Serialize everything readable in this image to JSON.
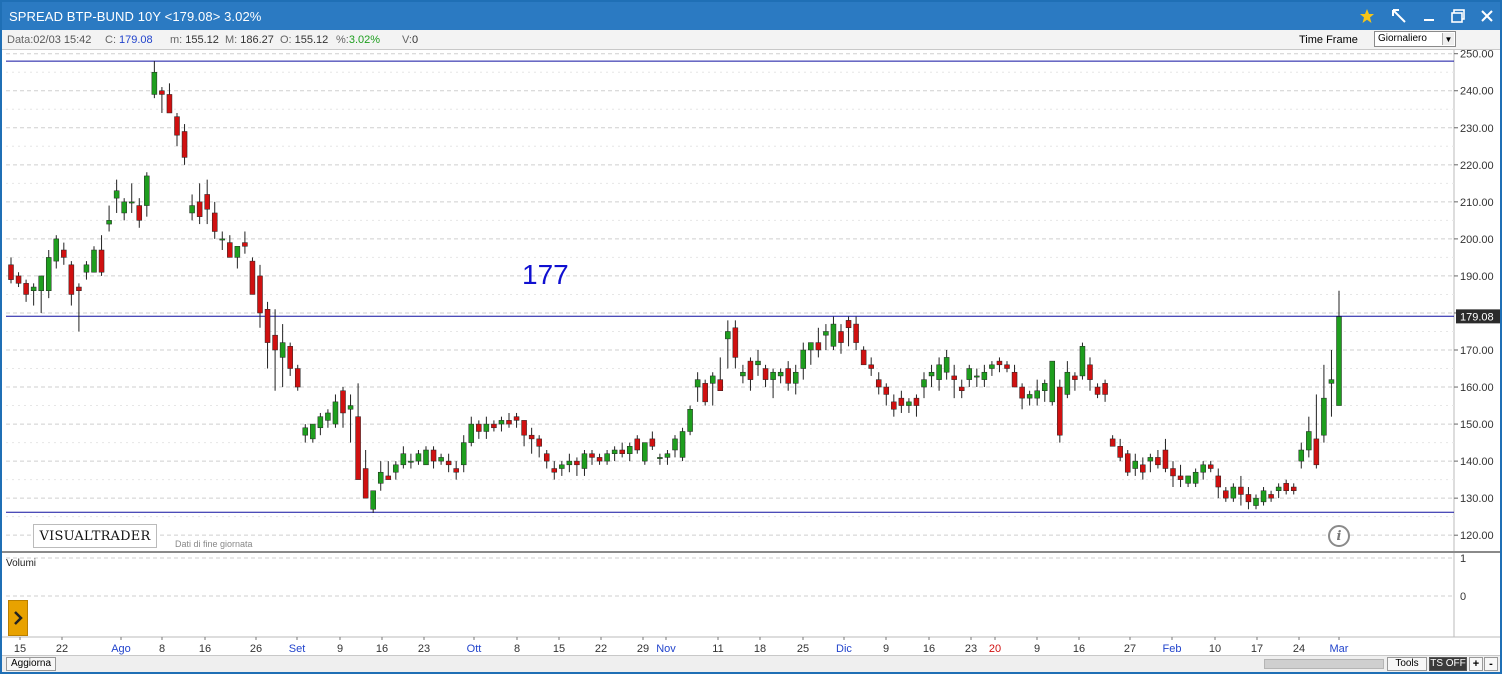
{
  "window": {
    "title": "SPREAD BTP-BUND 10Y <179.08> 3.02%"
  },
  "infobar": {
    "data_label": "Data:",
    "data_value": "02/03 15:42",
    "c_label": "C:",
    "c_value": "179.08",
    "m_label": "m:",
    "m_value": "155.12",
    "M_label": "M:",
    "M_value": "186.27",
    "o_label": "O:",
    "o_value": "155.12",
    "pct_label": "%:",
    "pct_value": "3.02%",
    "v_label": "V:",
    "v_value": "0",
    "time_frame_label": "Time Frame",
    "time_frame_value": "Giornaliero"
  },
  "branding": {
    "logo": "VISUALTRADER",
    "note": "Dati di fine giornata"
  },
  "bottom": {
    "aggiorna": "Aggiorna",
    "tools": "Tools",
    "ts_off": "TS OFF",
    "zoom_in": "+",
    "zoom_out": "-"
  },
  "colors": {
    "up": "#1e9e1e",
    "down": "#d01010",
    "line": "#1010a0",
    "month_label": "#2244cc",
    "special_label": "#d01010"
  },
  "chart_data": {
    "type": "candlestick",
    "title": "SPREAD BTP-BUND 10Y",
    "ylim": [
      116,
      251
    ],
    "yticks": [
      120,
      130,
      140,
      150,
      160,
      170,
      180,
      190,
      200,
      210,
      220,
      230,
      240,
      250
    ],
    "last_price": "179.08",
    "last_value": 179.08,
    "horizontal_lines": [
      248,
      179.1,
      126.2
    ],
    "annotation": "177",
    "volume_panel": {
      "label": "Volumi",
      "yticks": [
        "1",
        "0"
      ]
    },
    "x_labels": [
      {
        "label": "15",
        "type": "day"
      },
      {
        "label": "22",
        "type": "day"
      },
      {
        "label": "Ago",
        "type": "month"
      },
      {
        "label": "8",
        "type": "day"
      },
      {
        "label": "16",
        "type": "day"
      },
      {
        "label": "26",
        "type": "day"
      },
      {
        "label": "Set",
        "type": "month"
      },
      {
        "label": "9",
        "type": "day"
      },
      {
        "label": "16",
        "type": "day"
      },
      {
        "label": "23",
        "type": "day"
      },
      {
        "label": "Ott",
        "type": "month"
      },
      {
        "label": "8",
        "type": "day"
      },
      {
        "label": "15",
        "type": "day"
      },
      {
        "label": "22",
        "type": "day"
      },
      {
        "label": "29",
        "type": "day"
      },
      {
        "label": "Nov",
        "type": "month"
      },
      {
        "label": "11",
        "type": "day"
      },
      {
        "label": "18",
        "type": "day"
      },
      {
        "label": "25",
        "type": "day"
      },
      {
        "label": "Dic",
        "type": "month"
      },
      {
        "label": "9",
        "type": "day"
      },
      {
        "label": "16",
        "type": "day"
      },
      {
        "label": "23",
        "type": "day"
      },
      {
        "label": "20",
        "type": "special"
      },
      {
        "label": "9",
        "type": "day"
      },
      {
        "label": "16",
        "type": "day"
      },
      {
        "label": "27",
        "type": "day"
      },
      {
        "label": "Feb",
        "type": "month"
      },
      {
        "label": "10",
        "type": "day"
      },
      {
        "label": "17",
        "type": "day"
      },
      {
        "label": "24",
        "type": "day"
      },
      {
        "label": "Mar",
        "type": "month"
      }
    ],
    "candles": [
      [
        193,
        195,
        188,
        189
      ],
      [
        190,
        191,
        187,
        188
      ],
      [
        188,
        189,
        183,
        185
      ],
      [
        186,
        188,
        182,
        187
      ],
      [
        186,
        190,
        180,
        190
      ],
      [
        186,
        197,
        184,
        195
      ],
      [
        194,
        201,
        192,
        200
      ],
      [
        197,
        199,
        193,
        195
      ],
      [
        193,
        194,
        182,
        185
      ],
      [
        187,
        188,
        175,
        186
      ],
      [
        191,
        194,
        189,
        193
      ],
      [
        191,
        198,
        191,
        197
      ],
      [
        197,
        201,
        190,
        191
      ],
      [
        204,
        209,
        202,
        205
      ],
      [
        211,
        216,
        207,
        213
      ],
      [
        207,
        211,
        205,
        210
      ],
      [
        210,
        215,
        207,
        210
      ],
      [
        209,
        211,
        203,
        205
      ],
      [
        209,
        218,
        206,
        217
      ],
      [
        239,
        248,
        238,
        245
      ],
      [
        240,
        241,
        234,
        239
      ],
      [
        239,
        242,
        236,
        234
      ],
      [
        233,
        234,
        225,
        228
      ],
      [
        229,
        231,
        220,
        222
      ],
      [
        207,
        212,
        205,
        209
      ],
      [
        210,
        215,
        204,
        206
      ],
      [
        212,
        216,
        204,
        208
      ],
      [
        207,
        210,
        200,
        202
      ],
      [
        200,
        202,
        197,
        200
      ],
      [
        199,
        201,
        197,
        195
      ],
      [
        195,
        197,
        192,
        198
      ],
      [
        199,
        202,
        196,
        198
      ],
      [
        194,
        195,
        187,
        185
      ],
      [
        190,
        193,
        176,
        180
      ],
      [
        181,
        183,
        165,
        172
      ],
      [
        174,
        181,
        159,
        170
      ],
      [
        168,
        177,
        160,
        172
      ],
      [
        171,
        172,
        163,
        165
      ],
      [
        165,
        166,
        159,
        160
      ],
      [
        147,
        150,
        145,
        149
      ],
      [
        146,
        150,
        145,
        150
      ],
      [
        149,
        153,
        147,
        152
      ],
      [
        151,
        154,
        149,
        153
      ],
      [
        150,
        158,
        149,
        156
      ],
      [
        159,
        160,
        149,
        153
      ],
      [
        154,
        158,
        145,
        155
      ],
      [
        152,
        161,
        139,
        135
      ],
      [
        138,
        143,
        132,
        130
      ],
      [
        127,
        132,
        126,
        132
      ],
      [
        134,
        140,
        132,
        137
      ],
      [
        136,
        140,
        135,
        135
      ],
      [
        137,
        140,
        135,
        139
      ],
      [
        139,
        144,
        138,
        142
      ],
      [
        140,
        142,
        138,
        140
      ],
      [
        140,
        143,
        139,
        142
      ],
      [
        139,
        144,
        139,
        143
      ],
      [
        143,
        144,
        138,
        140
      ],
      [
        140,
        142,
        139,
        141
      ],
      [
        140,
        142,
        137,
        139
      ],
      [
        138,
        140,
        135,
        137
      ],
      [
        139,
        147,
        137,
        145
      ],
      [
        145,
        152,
        144,
        150
      ],
      [
        150,
        151,
        146,
        148
      ],
      [
        148,
        152,
        146,
        150
      ],
      [
        150,
        151,
        148,
        149
      ],
      [
        150,
        152,
        148,
        151
      ],
      [
        151,
        153,
        149,
        150
      ],
      [
        152,
        153,
        149,
        151
      ],
      [
        151,
        151,
        144,
        147
      ],
      [
        147,
        149,
        142,
        146
      ],
      [
        146,
        147,
        141,
        144
      ],
      [
        142,
        143,
        138,
        140
      ],
      [
        138,
        140,
        135,
        137
      ],
      [
        138,
        140,
        136,
        139
      ],
      [
        139,
        142,
        137,
        140
      ],
      [
        140,
        141,
        136,
        139
      ],
      [
        138,
        143,
        136,
        142
      ],
      [
        142,
        143,
        139,
        141
      ],
      [
        141,
        142,
        139,
        140
      ],
      [
        140,
        143,
        139,
        142
      ],
      [
        142,
        144,
        140,
        143
      ],
      [
        143,
        145,
        141,
        142
      ],
      [
        142,
        145,
        140,
        144
      ],
      [
        146,
        147,
        142,
        143
      ],
      [
        140,
        144,
        139,
        145
      ],
      [
        146,
        148,
        143,
        144
      ],
      [
        141,
        142,
        139,
        141
      ],
      [
        141,
        143,
        139,
        142
      ],
      [
        143,
        147,
        141,
        146
      ],
      [
        141,
        149,
        140,
        148
      ],
      [
        148,
        155,
        147,
        154
      ],
      [
        160,
        164,
        156,
        162
      ],
      [
        161,
        162,
        155,
        156
      ],
      [
        161,
        164,
        155,
        163
      ],
      [
        162,
        168,
        160,
        159
      ],
      [
        173,
        178,
        165,
        175
      ],
      [
        176,
        178,
        165,
        168
      ],
      [
        163,
        166,
        161,
        164
      ],
      [
        167,
        168,
        159,
        162
      ],
      [
        166,
        170,
        163,
        167
      ],
      [
        165,
        166,
        160,
        162
      ],
      [
        162,
        165,
        157,
        164
      ],
      [
        163,
        165,
        161,
        164
      ],
      [
        165,
        167,
        159,
        161
      ],
      [
        161,
        166,
        158,
        164
      ],
      [
        165,
        172,
        162,
        170
      ],
      [
        170,
        172,
        166,
        172
      ],
      [
        172,
        176,
        168,
        170
      ],
      [
        174,
        177,
        170,
        175
      ],
      [
        171,
        179,
        170,
        177
      ],
      [
        175,
        177,
        169,
        172
      ],
      [
        178,
        179,
        171,
        176
      ],
      [
        177,
        179,
        170,
        172
      ],
      [
        170,
        171,
        167,
        166
      ],
      [
        166,
        168,
        163,
        165
      ],
      [
        162,
        164,
        158,
        160
      ],
      [
        160,
        161,
        155,
        158
      ],
      [
        156,
        158,
        152,
        154
      ],
      [
        157,
        159,
        153,
        155
      ],
      [
        155,
        157,
        153,
        156
      ],
      [
        157,
        158,
        152,
        155
      ],
      [
        160,
        164,
        157,
        162
      ],
      [
        163,
        166,
        160,
        164
      ],
      [
        162,
        168,
        159,
        166
      ],
      [
        164,
        170,
        162,
        168
      ],
      [
        163,
        166,
        157,
        162
      ],
      [
        160,
        162,
        157,
        159
      ],
      [
        162,
        166,
        160,
        165
      ],
      [
        163,
        165,
        160,
        163
      ],
      [
        162,
        166,
        160,
        164
      ],
      [
        165,
        167,
        163,
        166
      ],
      [
        167,
        168,
        164,
        166
      ],
      [
        166,
        167,
        164,
        165
      ],
      [
        164,
        166,
        160,
        160
      ],
      [
        160,
        161,
        154,
        157
      ],
      [
        157,
        159,
        155,
        158
      ],
      [
        157,
        162,
        155,
        159
      ],
      [
        159,
        162,
        156,
        161
      ],
      [
        156,
        167,
        155,
        167
      ],
      [
        160,
        162,
        145,
        147
      ],
      [
        158,
        167,
        157,
        164
      ],
      [
        163,
        164,
        159,
        162
      ],
      [
        163,
        172,
        162,
        171
      ],
      [
        166,
        168,
        159,
        162
      ],
      [
        160,
        161,
        157,
        158
      ],
      [
        161,
        162,
        156,
        158
      ],
      [
        146,
        147,
        144,
        144
      ],
      [
        144,
        146,
        140,
        141
      ],
      [
        142,
        143,
        136,
        137
      ],
      [
        138,
        142,
        136,
        140
      ],
      [
        139,
        141,
        135,
        137
      ],
      [
        140,
        142,
        137,
        141
      ],
      [
        141,
        143,
        138,
        139
      ],
      [
        143,
        146,
        137,
        138
      ],
      [
        138,
        140,
        133,
        136
      ],
      [
        136,
        139,
        133,
        135
      ],
      [
        134,
        136,
        133,
        136
      ],
      [
        134,
        138,
        133,
        137
      ],
      [
        137,
        140,
        135,
        139
      ],
      [
        139,
        140,
        137,
        138
      ],
      [
        136,
        138,
        130,
        133
      ],
      [
        132,
        133,
        129,
        130
      ],
      [
        130,
        134,
        129,
        133
      ],
      [
        133,
        136,
        128,
        131
      ],
      [
        131,
        133,
        127,
        129
      ],
      [
        128,
        131,
        127,
        130
      ],
      [
        129,
        133,
        128,
        132
      ],
      [
        131,
        132,
        129,
        130
      ],
      [
        132,
        134,
        130,
        133
      ],
      [
        134,
        135,
        131,
        132
      ],
      [
        133,
        134,
        131,
        132
      ],
      [
        140,
        145,
        138,
        143
      ],
      [
        143,
        152,
        141,
        148
      ],
      [
        146,
        158,
        138,
        139
      ],
      [
        147,
        166,
        145,
        157
      ],
      [
        161,
        170,
        152,
        162
      ],
      [
        155,
        186,
        155,
        179
      ]
    ]
  }
}
